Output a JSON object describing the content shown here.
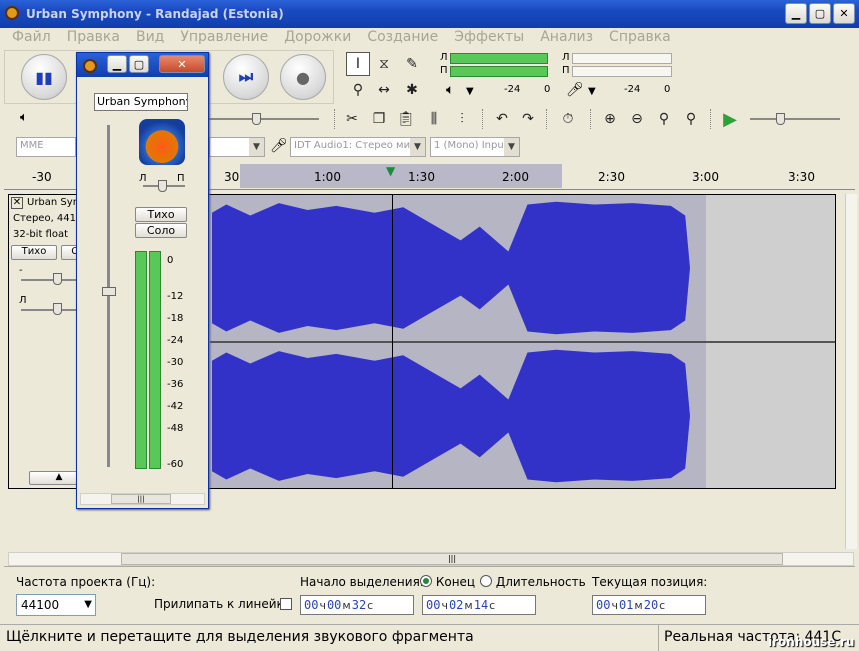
{
  "window": {
    "title": "Urban Symphony - Randajad (Estonia)"
  },
  "menu": [
    "Файл",
    "Правка",
    "Вид",
    "Управление",
    "Дорожки",
    "Создание",
    "Эффекты",
    "Анализ",
    "Справка"
  ],
  "meters": {
    "left": "Л",
    "right": "П",
    "play_db": "-24",
    "play_zero": "0",
    "rec_db": "-24",
    "rec_zero": "0"
  },
  "devices": {
    "host": "MME",
    "input": "IDT Audio1: Стерео мик",
    "channels": "1 (Mono) Input"
  },
  "ruler": {
    "ticks": [
      "-30",
      "30",
      "1:00",
      "1:30",
      "2:00",
      "2:30",
      "3:00",
      "3:30"
    ]
  },
  "track": {
    "name": "Urban Symphony - Randajad",
    "format": "Стерео, 44100Hz",
    "bitdepth": "32-bit float",
    "mute": "Тихо",
    "solo": "Соло",
    "gain_left": "-",
    "pan_left": "Л"
  },
  "mixer": {
    "track_select": "Urban Symphony -",
    "pan_left": "Л",
    "pan_right": "П",
    "mute": "Тихо",
    "solo": "Соло",
    "scale": [
      "0",
      "-12",
      "-18",
      "-24",
      "-30",
      "-36",
      "-42",
      "-48",
      "-60"
    ]
  },
  "bottom": {
    "rate_label": "Частота проекта (Гц):",
    "rate_value": "44100",
    "snap_label": "Прилипать к линейке",
    "sel_start_label": "Начало выделения:",
    "end_label": "Конец",
    "len_label": "Длительность",
    "pos_label": "Текущая позиция:",
    "t1": {
      "h": "00",
      "m": "00",
      "s": "32"
    },
    "t2": {
      "h": "00",
      "m": "02",
      "s": "14"
    },
    "t3": {
      "h": "00",
      "m": "01",
      "s": "20"
    },
    "u_h": "ч",
    "u_m": "м",
    "u_s": "с"
  },
  "status": {
    "hint": "Щёлкните и перетащите для выделения звукового фрагмента",
    "rate": "Реальная частота: 441С",
    "watermark": "ironhouse.ru"
  }
}
